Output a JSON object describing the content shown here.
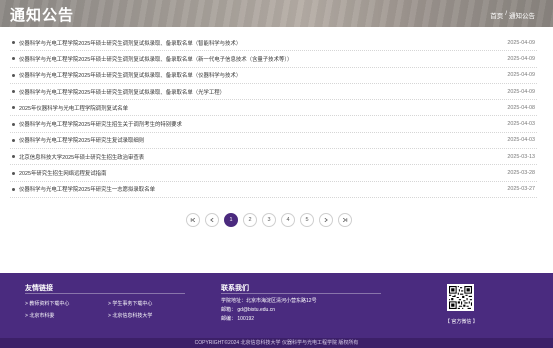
{
  "header": {
    "title": "通知公告",
    "breadcrumb": {
      "home": "首页",
      "sep": "/",
      "current": "通知公告"
    }
  },
  "notices": [
    {
      "title": "仪器科学与光电工程学院2025年硕士研究生调剂复试拟录取、备录取名单（智能科学与技术）",
      "date": "2025-04-09"
    },
    {
      "title": "仪器科学与光电工程学院2025年硕士研究生调剂复试拟录取、备录取名单（新一代电子信息技术（含量子技术等））",
      "date": "2025-04-09"
    },
    {
      "title": "仪器科学与光电工程学院2025年硕士研究生调剂复试拟录取、备录取名单（仪器科学与技术）",
      "date": "2025-04-09"
    },
    {
      "title": "仪器科学与光电工程学院2025年硕士研究生调剂复试拟录取、备录取名单（光学工程）",
      "date": "2025-04-09"
    },
    {
      "title": "2025年仪器科学与光电工程学院调剂复试名单",
      "date": "2025-04-08"
    },
    {
      "title": "仪器科学与光电工程学院2025年研究生招生关于调剂考生的特别要求",
      "date": "2025-04-03"
    },
    {
      "title": "仪器科学与光电工程学院2025年研究生复试录取细则",
      "date": "2025-04-03"
    },
    {
      "title": "北京信息科技大学2025年硕士研究生招生政治审查表",
      "date": "2025-03-13"
    },
    {
      "title": "2025年研究生招生网络远程复试指南",
      "date": "2025-03-28"
    },
    {
      "title": "仪器科学与光电工程学院2025年研究生一志愿拟录取名单",
      "date": "2025-03-27"
    }
  ],
  "pagination": {
    "first_icon": "first-page-icon",
    "prev_icon": "prev-page-icon",
    "pages": [
      "1",
      "2",
      "3",
      "4",
      "5"
    ],
    "current": "1",
    "next_icon": "next-page-icon",
    "last_icon": "last-page-icon"
  },
  "footer": {
    "links_heading": "友情链接",
    "links": [
      "教师资料下载中心",
      "学生事务下载中心",
      "北京市科委",
      "北京信息科技大学"
    ],
    "link_marker": ">",
    "contact_heading": "联系我们",
    "address": "学院地址：北京市海淀区清河小营东路12号",
    "email": "邮箱：  gd@bistu.edu.cn",
    "postcode": "邮编：  100192",
    "qr_label": "【 官方微信 】",
    "copyright": "COPYRIGHT©2024  北京信息科技大学 仪器科学与光电工程学院 版权所有"
  },
  "colors": {
    "footer_bg": "#4a2b7f",
    "active_page": "#4b2a7e"
  }
}
